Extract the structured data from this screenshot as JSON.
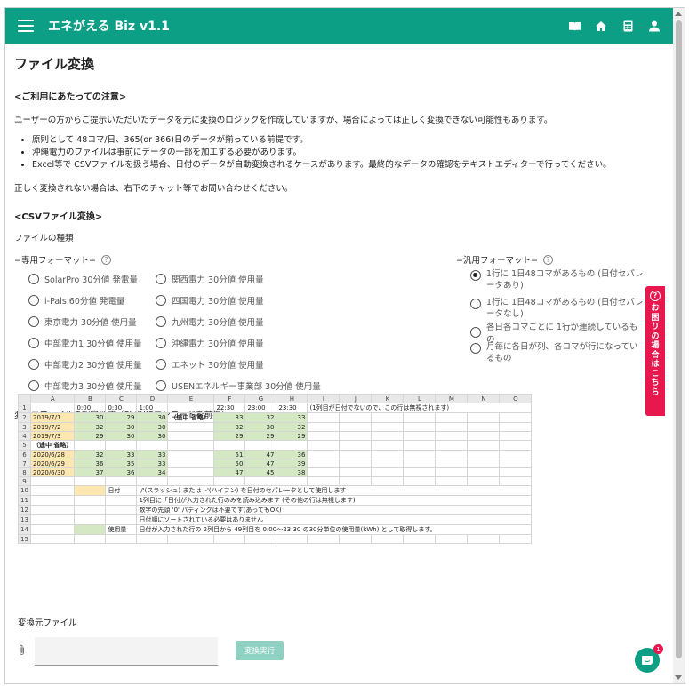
{
  "app": {
    "title": "エネがえる Biz v1.1"
  },
  "page": {
    "title": "ファイル変換"
  },
  "notice": {
    "heading": "<ご利用にあたっての注意>",
    "intro": "ユーザーの方からご提示いただいたデータを元に変換のロジックを作成していますが、場合によっては正しく変換できない可能性もあります。",
    "bullets": [
      "原則として 48コマ/日、365(or 366)日のデータが揃っている前提です。",
      "沖縄電力のファイルは事前にデータの一部を加工する必要があります。",
      "Excel等で CSVファイルを扱う場合、日付のデータが自動変換されるケースがあります。最終的なデータの確認をテキストエディターで行ってください。"
    ],
    "contact": "正しく変換されない場合は、右下のチャット等でお問い合わせください。"
  },
  "csv": {
    "heading": "<CSVファイル変換>",
    "type_label": "ファイルの種類",
    "dedicated_title": "−専用フォーマット−",
    "general_title": "−汎用フォーマット−",
    "dedicated_col1": [
      "SolarPro 30分値 発電量",
      "i-Pals 60分値 発電量",
      "東京電力 30分値 使用量",
      "中部電力1 30分値 使用量",
      "中部電力2 30分値 使用量",
      "中部電力3 30分値 使用量"
    ],
    "dedicated_col2": [
      "関西電力 30分値 使用量",
      "四国電力 30分値 使用量",
      "九州電力 30分値 使用量",
      "沖縄電力 30分値 使用量",
      "エネット 30分値 使用量",
      "USENエネルギー事業部 30分値 使用量"
    ],
    "general_options": [
      "1行に 1日48コマがあるもの (日付セパレータあり)",
      "1行に 1日48コマがあるもの (日付セパレータなし)",
      "各日各コマごとに 1行が連続しているもの",
      "月毎に各日が列、各コマが行になっているもの"
    ],
    "format_label": "変換元ファイルの想定形式（ShiftJISエンコードを前提）"
  },
  "sheet": {
    "cols": [
      "",
      "A",
      "B",
      "C",
      "D",
      "E",
      "F",
      "G",
      "H",
      "I",
      "J",
      "K",
      "L",
      "M",
      "N",
      "O"
    ],
    "rows": [
      [
        "1",
        "",
        "0:00",
        "0:30",
        "1:00",
        "",
        "22:30",
        "23:00",
        "23:30",
        "(1列目が日付でないので、この行は無視されます)",
        "",
        "",
        "",
        "",
        "",
        ""
      ],
      [
        "2",
        "2019/7/1",
        "30",
        "29",
        "30",
        "（途中 省略）",
        "33",
        "32",
        "33",
        "",
        "",
        "",
        "",
        "",
        "",
        ""
      ],
      [
        "3",
        "2019/7/2",
        "32",
        "30",
        "30",
        "",
        "32",
        "30",
        "32",
        "",
        "",
        "",
        "",
        "",
        "",
        ""
      ],
      [
        "4",
        "2019/7/3",
        "29",
        "30",
        "30",
        "",
        "29",
        "29",
        "29",
        "",
        "",
        "",
        "",
        "",
        "",
        ""
      ],
      [
        "5",
        "（途中 省略）",
        "",
        "",
        "",
        "",
        "",
        "",
        "",
        "",
        "",
        "",
        "",
        "",
        "",
        ""
      ],
      [
        "6",
        "2020/6/28",
        "32",
        "33",
        "33",
        "",
        "51",
        "47",
        "36",
        "",
        "",
        "",
        "",
        "",
        "",
        ""
      ],
      [
        "7",
        "2020/6/29",
        "36",
        "35",
        "33",
        "",
        "50",
        "47",
        "39",
        "",
        "",
        "",
        "",
        "",
        "",
        ""
      ],
      [
        "8",
        "2020/6/30",
        "37",
        "36",
        "34",
        "",
        "47",
        "45",
        "38",
        "",
        "",
        "",
        "",
        "",
        "",
        ""
      ],
      [
        "9",
        "",
        "",
        "",
        "",
        "",
        "",
        "",
        "",
        "",
        "",
        "",
        "",
        "",
        "",
        ""
      ],
      [
        "10",
        "",
        "",
        "日付",
        "'/'(スラッシュ) または '-'(ハイフン) を日付のセパレータとして使用します",
        "",
        "",
        "",
        "",
        "",
        "",
        "",
        "",
        "",
        "",
        ""
      ],
      [
        "11",
        "",
        "",
        "",
        "1列目に「日付が入力された行のみを読み込みます (その他の行は無視します)",
        "",
        "",
        "",
        "",
        "",
        "",
        "",
        "",
        "",
        "",
        ""
      ],
      [
        "12",
        "",
        "",
        "",
        "数字の先頭 '0' パディングは不要です(あってもOK)",
        "",
        "",
        "",
        "",
        "",
        "",
        "",
        "",
        "",
        "",
        ""
      ],
      [
        "13",
        "",
        "",
        "",
        "日付順にソートされている必要はありません",
        "",
        "",
        "",
        "",
        "",
        "",
        "",
        "",
        "",
        "",
        ""
      ],
      [
        "14",
        "",
        "",
        "使用量",
        "日付が入力された行の 2列目から 49列目を 0:00〜23:30 の30分単位の使用量(kWh) として取得します。",
        "",
        "",
        "",
        "",
        "",
        "",
        "",
        "",
        "",
        "",
        ""
      ],
      [
        "15",
        "",
        "",
        "",
        "",
        "",
        "",
        "",
        "",
        "",
        "",
        "",
        "",
        "",
        "",
        ""
      ]
    ]
  },
  "upload": {
    "label": "変換元ファイル",
    "button": "変換実行"
  },
  "chat": {
    "label": "お困りの場合はこちら",
    "badge": "1"
  }
}
